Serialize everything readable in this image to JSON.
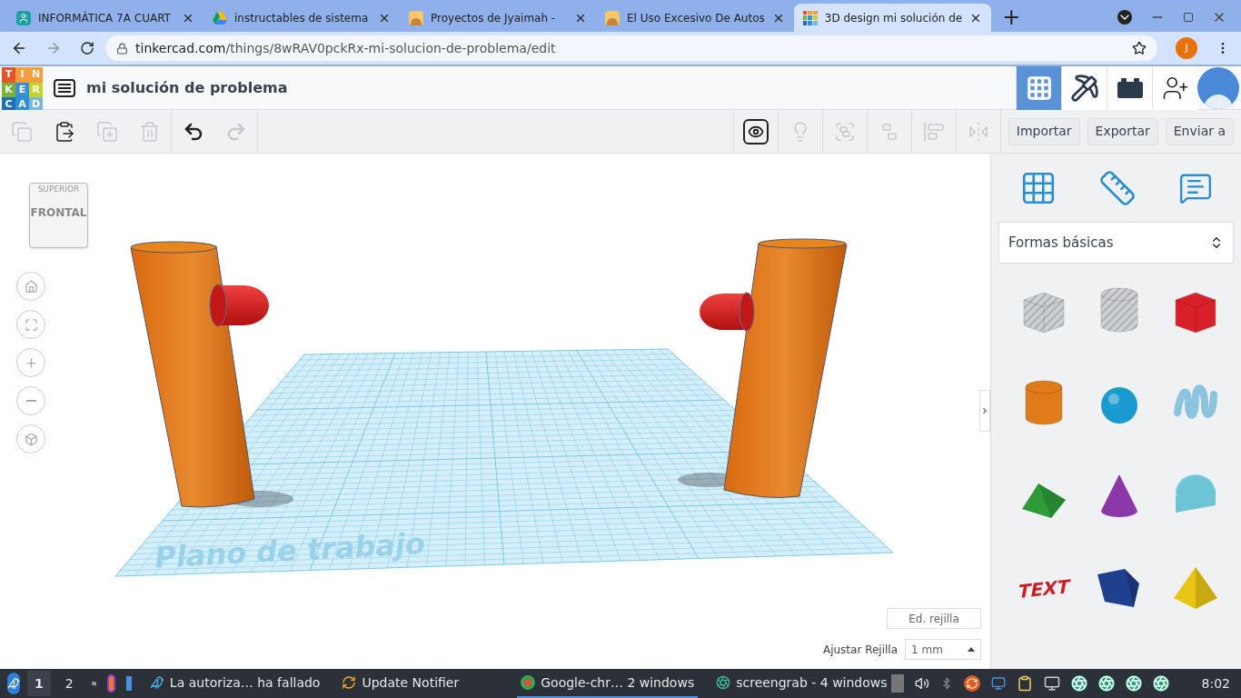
{
  "browser": {
    "tabs": [
      {
        "kind": "classroom",
        "title": "INFORMÁTICA 7A CUART",
        "selected": false
      },
      {
        "kind": "drive",
        "title": "instructables de sistema",
        "selected": false
      },
      {
        "kind": "avatar",
        "title": "Proyectos de Jyaimah -",
        "selected": false
      },
      {
        "kind": "avatar",
        "title": "El Uso Excesivo De Autos",
        "selected": false
      },
      {
        "kind": "tinkercad",
        "title": "3D design mi solución de",
        "selected": true
      }
    ],
    "new_tab": "+",
    "url_host": "tinkercad.com",
    "url_path": "/things/8wRAV0pckRx-mi-solucion-de-problema/edit",
    "profile_initial": "J"
  },
  "app": {
    "logo_letters": [
      "T",
      "I",
      "N",
      "K",
      "E",
      "R",
      "C",
      "A",
      "D"
    ],
    "design_title": "mi solución de problema",
    "views": [
      {
        "kind": "grid",
        "selected": true
      },
      {
        "kind": "pickaxe",
        "selected": false
      },
      {
        "kind": "brick",
        "selected": false
      }
    ],
    "tools": [
      {
        "kind": "copy",
        "disabled": true
      },
      {
        "kind": "paste",
        "disabled": false
      },
      {
        "kind": "duplicate",
        "disabled": true
      },
      {
        "kind": "delete",
        "disabled": true
      },
      {
        "kind": "undo",
        "disabled": false
      },
      {
        "kind": "redo",
        "disabled": true
      }
    ],
    "view_tools": [
      {
        "kind": "note",
        "disabled": false
      },
      {
        "kind": "light",
        "disabled": true
      },
      {
        "kind": "group",
        "disabled": true
      },
      {
        "kind": "ungroup",
        "disabled": true
      },
      {
        "kind": "align",
        "disabled": true
      },
      {
        "kind": "mirror",
        "disabled": true
      }
    ],
    "actions": [
      "Importar",
      "Exportar",
      "Enviar a"
    ]
  },
  "canvas": {
    "view_cube": {
      "top": "SUPERIOR",
      "front": "FRONTAL"
    },
    "workplane_label": "Plano de trabajo",
    "edit_grid": "Ed. rejilla",
    "snap_label": "Ajustar Rejilla",
    "snap_value": "1 mm"
  },
  "panel": {
    "category": "Formas básicas",
    "shapes": [
      {
        "kind": "box",
        "color": "#c4c8cc",
        "hole": true
      },
      {
        "kind": "cylinder",
        "color": "#c4c8cc",
        "hole": true
      },
      {
        "kind": "box",
        "color": "#d9202a",
        "hole": false
      },
      {
        "kind": "cylinder",
        "color": "#e07b1a",
        "hole": false
      },
      {
        "kind": "sphere",
        "color": "#1a9bd0",
        "hole": false
      },
      {
        "kind": "scribble",
        "color": "#8cc4e0",
        "hole": false
      },
      {
        "kind": "roof",
        "color": "#2e9a3a",
        "hole": false
      },
      {
        "kind": "cone",
        "color": "#8a3aa8",
        "hole": false
      },
      {
        "kind": "round-roof",
        "color": "#6cc4d4",
        "hole": false
      },
      {
        "kind": "text",
        "color": "#c8202a",
        "hole": false,
        "label": "TEXT"
      },
      {
        "kind": "polygon",
        "color": "#1f3f8f",
        "hole": false
      },
      {
        "kind": "pyramid",
        "color": "#e8c414",
        "hole": false
      }
    ]
  },
  "taskbar": {
    "workspaces": [
      {
        "label": "1",
        "selected": true
      },
      {
        "label": "2",
        "selected": false
      }
    ],
    "windows": [
      {
        "kind": "bird",
        "label": "La autoriza… ha fallado",
        "selected": false
      },
      {
        "kind": "update",
        "label": "Update Notifier",
        "selected": false
      },
      {
        "kind": "chrome",
        "label": "Google-chr… 2 windows",
        "selected": true
      },
      {
        "kind": "camera",
        "label": "screengrab - 4 windows",
        "selected": false
      }
    ],
    "clock": "8:02"
  }
}
